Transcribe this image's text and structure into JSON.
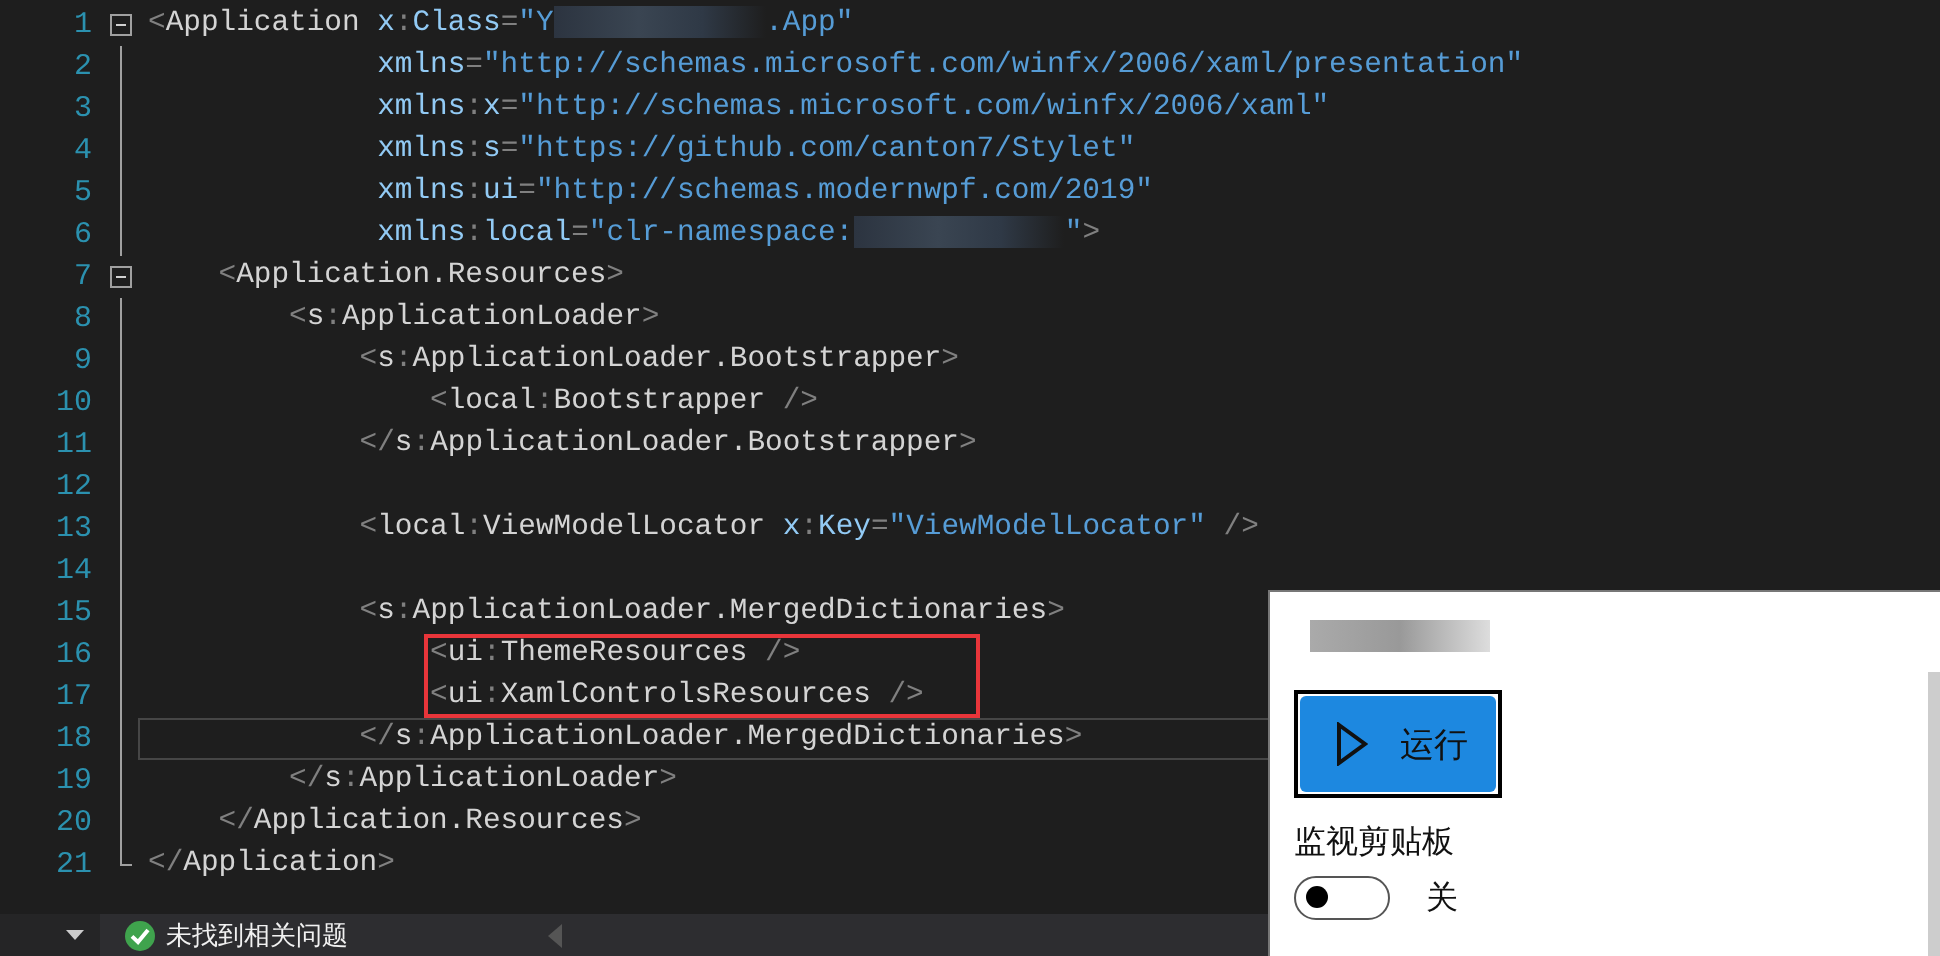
{
  "editor": {
    "lines": [
      {
        "number": "1",
        "fold": true,
        "current": false,
        "boxed": false,
        "tokens": [
          {
            "kind": "p",
            "text": "<"
          },
          {
            "kind": "e",
            "text": "Application "
          },
          {
            "kind": "a",
            "text": "x"
          },
          {
            "kind": "p",
            "text": ":"
          },
          {
            "kind": "a",
            "text": "Class"
          },
          {
            "kind": "p",
            "text": "="
          },
          {
            "kind": "v",
            "text": "\"Y"
          },
          {
            "kind": "redacted"
          },
          {
            "kind": "v",
            "text": ".App\""
          }
        ]
      },
      {
        "number": "2",
        "fold": false,
        "current": false,
        "boxed": false,
        "tokens": [
          {
            "kind": "a",
            "text": "             xmlns"
          },
          {
            "kind": "p",
            "text": "="
          },
          {
            "kind": "v",
            "text": "\"http://schemas.microsoft.com/winfx/2006/xaml/presentation\""
          }
        ]
      },
      {
        "number": "3",
        "fold": false,
        "current": false,
        "boxed": false,
        "tokens": [
          {
            "kind": "a",
            "text": "             xmlns"
          },
          {
            "kind": "p",
            "text": ":"
          },
          {
            "kind": "a",
            "text": "x"
          },
          {
            "kind": "p",
            "text": "="
          },
          {
            "kind": "v",
            "text": "\"http://schemas.microsoft.com/winfx/2006/xaml\""
          }
        ]
      },
      {
        "number": "4",
        "fold": false,
        "current": false,
        "boxed": false,
        "tokens": [
          {
            "kind": "a",
            "text": "             xmlns"
          },
          {
            "kind": "p",
            "text": ":"
          },
          {
            "kind": "a",
            "text": "s"
          },
          {
            "kind": "p",
            "text": "="
          },
          {
            "kind": "v",
            "text": "\"https://github.com/canton7/Stylet\""
          }
        ]
      },
      {
        "number": "5",
        "fold": false,
        "current": false,
        "boxed": false,
        "tokens": [
          {
            "kind": "a",
            "text": "             xmlns"
          },
          {
            "kind": "p",
            "text": ":"
          },
          {
            "kind": "a",
            "text": "ui"
          },
          {
            "kind": "p",
            "text": "="
          },
          {
            "kind": "v",
            "text": "\"http://schemas.modernwpf.com/2019\""
          }
        ]
      },
      {
        "number": "6",
        "fold": false,
        "current": false,
        "boxed": false,
        "tokens": [
          {
            "kind": "a",
            "text": "             xmlns"
          },
          {
            "kind": "p",
            "text": ":"
          },
          {
            "kind": "a",
            "text": "local"
          },
          {
            "kind": "p",
            "text": "="
          },
          {
            "kind": "v",
            "text": "\"clr-namespace:"
          },
          {
            "kind": "redacted"
          },
          {
            "kind": "v",
            "text": "\""
          },
          {
            "kind": "p",
            "text": ">"
          }
        ]
      },
      {
        "number": "7",
        "fold": true,
        "current": false,
        "boxed": false,
        "tokens": [
          {
            "kind": "p",
            "text": "    <"
          },
          {
            "kind": "e",
            "text": "Application.Resources"
          },
          {
            "kind": "p",
            "text": ">"
          }
        ]
      },
      {
        "number": "8",
        "fold": false,
        "current": false,
        "boxed": false,
        "tokens": [
          {
            "kind": "p",
            "text": "        <"
          },
          {
            "kind": "e",
            "text": "s"
          },
          {
            "kind": "p",
            "text": ":"
          },
          {
            "kind": "e",
            "text": "ApplicationLoader"
          },
          {
            "kind": "p",
            "text": ">"
          }
        ]
      },
      {
        "number": "9",
        "fold": false,
        "current": false,
        "boxed": false,
        "tokens": [
          {
            "kind": "p",
            "text": "            <"
          },
          {
            "kind": "e",
            "text": "s"
          },
          {
            "kind": "p",
            "text": ":"
          },
          {
            "kind": "e",
            "text": "ApplicationLoader.Bootstrapper"
          },
          {
            "kind": "p",
            "text": ">"
          }
        ]
      },
      {
        "number": "10",
        "fold": false,
        "current": false,
        "boxed": false,
        "tokens": [
          {
            "kind": "p",
            "text": "                <"
          },
          {
            "kind": "e",
            "text": "local"
          },
          {
            "kind": "p",
            "text": ":"
          },
          {
            "kind": "e",
            "text": "Bootstrapper"
          },
          {
            "kind": "p",
            "text": " />"
          }
        ]
      },
      {
        "number": "11",
        "fold": false,
        "current": false,
        "boxed": false,
        "tokens": [
          {
            "kind": "p",
            "text": "            </"
          },
          {
            "kind": "e",
            "text": "s"
          },
          {
            "kind": "p",
            "text": ":"
          },
          {
            "kind": "e",
            "text": "ApplicationLoader.Bootstrapper"
          },
          {
            "kind": "p",
            "text": ">"
          }
        ]
      },
      {
        "number": "12",
        "fold": false,
        "current": false,
        "boxed": false
      },
      {
        "number": "13",
        "fold": false,
        "current": false,
        "boxed": false,
        "tokens": [
          {
            "kind": "p",
            "text": "            <"
          },
          {
            "kind": "e",
            "text": "local"
          },
          {
            "kind": "p",
            "text": ":"
          },
          {
            "kind": "e",
            "text": "ViewModelLocator "
          },
          {
            "kind": "a",
            "text": "x"
          },
          {
            "kind": "p",
            "text": ":"
          },
          {
            "kind": "a",
            "text": "Key"
          },
          {
            "kind": "p",
            "text": "="
          },
          {
            "kind": "v",
            "text": "\"ViewModelLocator\""
          },
          {
            "kind": "p",
            "text": " />"
          }
        ]
      },
      {
        "number": "14",
        "fold": false,
        "current": false,
        "boxed": false
      },
      {
        "number": "15",
        "fold": false,
        "current": false,
        "boxed": false,
        "tokens": [
          {
            "kind": "p",
            "text": "            <"
          },
          {
            "kind": "e",
            "text": "s"
          },
          {
            "kind": "p",
            "text": ":"
          },
          {
            "kind": "e",
            "text": "ApplicationLoader.MergedDictionaries"
          },
          {
            "kind": "p",
            "text": ">"
          }
        ]
      },
      {
        "number": "16",
        "fold": false,
        "current": false,
        "boxed": true,
        "tokens": [
          {
            "kind": "p",
            "text": "                <"
          },
          {
            "kind": "e",
            "text": "ui"
          },
          {
            "kind": "p",
            "text": ":"
          },
          {
            "kind": "e",
            "text": "ThemeResources"
          },
          {
            "kind": "p",
            "text": " />"
          }
        ]
      },
      {
        "number": "17",
        "fold": false,
        "current": false,
        "boxed": true,
        "tokens": [
          {
            "kind": "p",
            "text": "                <"
          },
          {
            "kind": "e",
            "text": "ui"
          },
          {
            "kind": "p",
            "text": ":"
          },
          {
            "kind": "e",
            "text": "XamlControlsResources"
          },
          {
            "kind": "p",
            "text": " />"
          }
        ]
      },
      {
        "number": "18",
        "fold": false,
        "current": true,
        "boxed": false,
        "tokens": [
          {
            "kind": "p",
            "text": "            </"
          },
          {
            "kind": "e",
            "text": "s"
          },
          {
            "kind": "p",
            "text": ":"
          },
          {
            "kind": "e",
            "text": "ApplicationLoader.MergedDictionaries"
          },
          {
            "kind": "p",
            "text": ">"
          }
        ]
      },
      {
        "number": "19",
        "fold": false,
        "current": false,
        "boxed": false,
        "tokens": [
          {
            "kind": "p",
            "text": "        </"
          },
          {
            "kind": "e",
            "text": "s"
          },
          {
            "kind": "p",
            "text": ":"
          },
          {
            "kind": "e",
            "text": "ApplicationLoader"
          },
          {
            "kind": "p",
            "text": ">"
          }
        ]
      },
      {
        "number": "20",
        "fold": false,
        "current": false,
        "boxed": false,
        "tokens": [
          {
            "kind": "p",
            "text": "    </"
          },
          {
            "kind": "e",
            "text": "Application.Resources"
          },
          {
            "kind": "p",
            "text": ">"
          }
        ]
      },
      {
        "number": "21",
        "fold": false,
        "current": false,
        "boxed": false,
        "tokens": [
          {
            "kind": "p",
            "text": "</"
          },
          {
            "kind": "e",
            "text": "Application"
          },
          {
            "kind": "p",
            "text": ">"
          }
        ]
      }
    ]
  },
  "status_bar": {
    "message": "未找到相关问题"
  },
  "panel": {
    "run_button": "运行",
    "monitor": {
      "label": "监视剪贴板",
      "on": false,
      "state_text": "关"
    }
  }
}
